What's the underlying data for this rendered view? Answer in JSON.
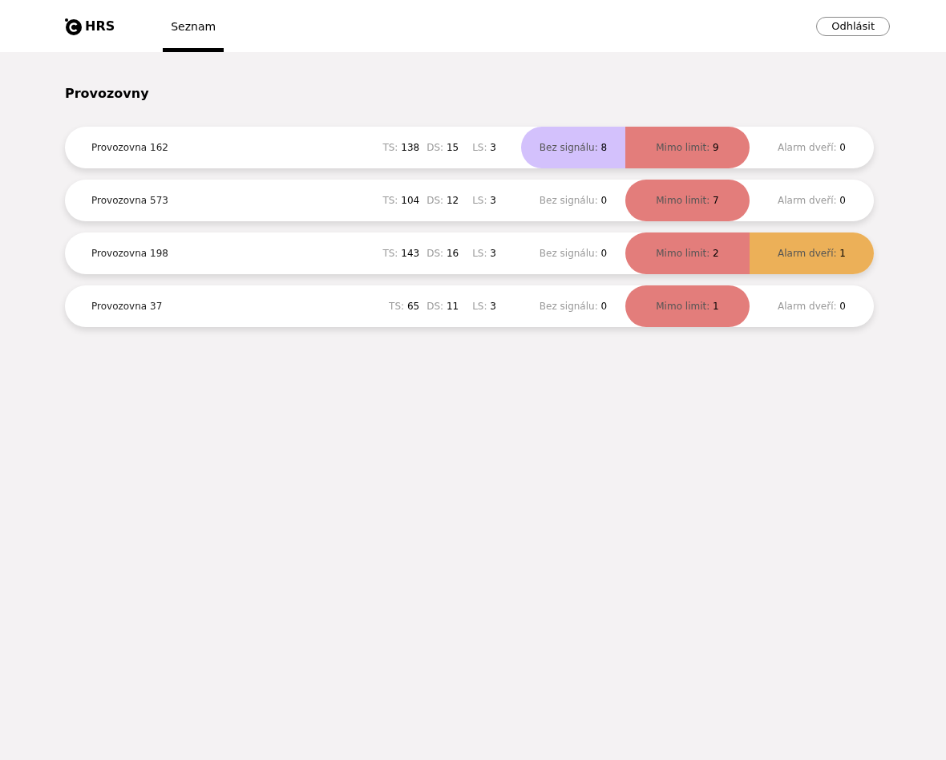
{
  "header": {
    "logo_text": "HRS",
    "tabs": [
      {
        "label": "Seznam",
        "selected": true
      }
    ],
    "logout_button": "Odhlásit"
  },
  "page_title": "Provozovny",
  "rows": [
    {
      "name": "Provozovna 162",
      "stats": [
        {
          "label": "TS:",
          "value": "138"
        },
        {
          "label": "DS:",
          "value": "15"
        },
        {
          "label": "LS:",
          "value": "3"
        }
      ],
      "alerts": [
        {
          "label": "Bez signálu:",
          "value": "8",
          "active": true,
          "color": "#d3c1fc"
        },
        {
          "label": "Mimo limit:",
          "value": "9",
          "active": true,
          "color": "#e37d7b"
        },
        {
          "label": "Alarm dveří:",
          "value": "0",
          "active": false
        }
      ]
    },
    {
      "name": "Provozovna 573",
      "stats": [
        {
          "label": "TS:",
          "value": "104"
        },
        {
          "label": "DS:",
          "value": "12"
        },
        {
          "label": "LS:",
          "value": "3"
        }
      ],
      "alerts": [
        {
          "label": "Bez signálu:",
          "value": "0",
          "active": false
        },
        {
          "label": "Mimo limit:",
          "value": "7",
          "active": true,
          "color": "#e37d7b"
        },
        {
          "label": "Alarm dveří:",
          "value": "0",
          "active": false
        }
      ]
    },
    {
      "name": "Provozovna 198",
      "stats": [
        {
          "label": "TS:",
          "value": "143"
        },
        {
          "label": "DS:",
          "value": "16"
        },
        {
          "label": "LS:",
          "value": "3"
        }
      ],
      "alerts": [
        {
          "label": "Bez signálu:",
          "value": "0",
          "active": false
        },
        {
          "label": "Mimo limit:",
          "value": "2",
          "active": true,
          "color": "#e37d7b"
        },
        {
          "label": "Alarm dveří:",
          "value": "1",
          "active": true,
          "color": "#ecb058"
        }
      ]
    },
    {
      "name": "Provozovna 37",
      "stats": [
        {
          "label": "TS:",
          "value": "65"
        },
        {
          "label": "DS:",
          "value": "11"
        },
        {
          "label": "LS:",
          "value": "3"
        }
      ],
      "alerts": [
        {
          "label": "Bez signálu:",
          "value": "0",
          "active": false
        },
        {
          "label": "Mimo limit:",
          "value": "1",
          "active": true,
          "color": "#e37d7b"
        },
        {
          "label": "Alarm dveří:",
          "value": "0",
          "active": false
        }
      ]
    }
  ]
}
